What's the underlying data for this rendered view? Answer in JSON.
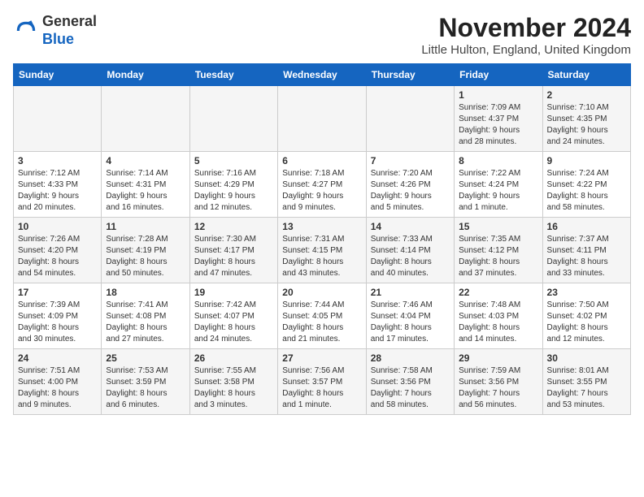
{
  "header": {
    "logo_line1": "General",
    "logo_line2": "Blue",
    "month_title": "November 2024",
    "location": "Little Hulton, England, United Kingdom"
  },
  "weekdays": [
    "Sunday",
    "Monday",
    "Tuesday",
    "Wednesday",
    "Thursday",
    "Friday",
    "Saturday"
  ],
  "weeks": [
    [
      {
        "day": "",
        "info": ""
      },
      {
        "day": "",
        "info": ""
      },
      {
        "day": "",
        "info": ""
      },
      {
        "day": "",
        "info": ""
      },
      {
        "day": "",
        "info": ""
      },
      {
        "day": "1",
        "info": "Sunrise: 7:09 AM\nSunset: 4:37 PM\nDaylight: 9 hours\nand 28 minutes."
      },
      {
        "day": "2",
        "info": "Sunrise: 7:10 AM\nSunset: 4:35 PM\nDaylight: 9 hours\nand 24 minutes."
      }
    ],
    [
      {
        "day": "3",
        "info": "Sunrise: 7:12 AM\nSunset: 4:33 PM\nDaylight: 9 hours\nand 20 minutes."
      },
      {
        "day": "4",
        "info": "Sunrise: 7:14 AM\nSunset: 4:31 PM\nDaylight: 9 hours\nand 16 minutes."
      },
      {
        "day": "5",
        "info": "Sunrise: 7:16 AM\nSunset: 4:29 PM\nDaylight: 9 hours\nand 12 minutes."
      },
      {
        "day": "6",
        "info": "Sunrise: 7:18 AM\nSunset: 4:27 PM\nDaylight: 9 hours\nand 9 minutes."
      },
      {
        "day": "7",
        "info": "Sunrise: 7:20 AM\nSunset: 4:26 PM\nDaylight: 9 hours\nand 5 minutes."
      },
      {
        "day": "8",
        "info": "Sunrise: 7:22 AM\nSunset: 4:24 PM\nDaylight: 9 hours\nand 1 minute."
      },
      {
        "day": "9",
        "info": "Sunrise: 7:24 AM\nSunset: 4:22 PM\nDaylight: 8 hours\nand 58 minutes."
      }
    ],
    [
      {
        "day": "10",
        "info": "Sunrise: 7:26 AM\nSunset: 4:20 PM\nDaylight: 8 hours\nand 54 minutes."
      },
      {
        "day": "11",
        "info": "Sunrise: 7:28 AM\nSunset: 4:19 PM\nDaylight: 8 hours\nand 50 minutes."
      },
      {
        "day": "12",
        "info": "Sunrise: 7:30 AM\nSunset: 4:17 PM\nDaylight: 8 hours\nand 47 minutes."
      },
      {
        "day": "13",
        "info": "Sunrise: 7:31 AM\nSunset: 4:15 PM\nDaylight: 8 hours\nand 43 minutes."
      },
      {
        "day": "14",
        "info": "Sunrise: 7:33 AM\nSunset: 4:14 PM\nDaylight: 8 hours\nand 40 minutes."
      },
      {
        "day": "15",
        "info": "Sunrise: 7:35 AM\nSunset: 4:12 PM\nDaylight: 8 hours\nand 37 minutes."
      },
      {
        "day": "16",
        "info": "Sunrise: 7:37 AM\nSunset: 4:11 PM\nDaylight: 8 hours\nand 33 minutes."
      }
    ],
    [
      {
        "day": "17",
        "info": "Sunrise: 7:39 AM\nSunset: 4:09 PM\nDaylight: 8 hours\nand 30 minutes."
      },
      {
        "day": "18",
        "info": "Sunrise: 7:41 AM\nSunset: 4:08 PM\nDaylight: 8 hours\nand 27 minutes."
      },
      {
        "day": "19",
        "info": "Sunrise: 7:42 AM\nSunset: 4:07 PM\nDaylight: 8 hours\nand 24 minutes."
      },
      {
        "day": "20",
        "info": "Sunrise: 7:44 AM\nSunset: 4:05 PM\nDaylight: 8 hours\nand 21 minutes."
      },
      {
        "day": "21",
        "info": "Sunrise: 7:46 AM\nSunset: 4:04 PM\nDaylight: 8 hours\nand 17 minutes."
      },
      {
        "day": "22",
        "info": "Sunrise: 7:48 AM\nSunset: 4:03 PM\nDaylight: 8 hours\nand 14 minutes."
      },
      {
        "day": "23",
        "info": "Sunrise: 7:50 AM\nSunset: 4:02 PM\nDaylight: 8 hours\nand 12 minutes."
      }
    ],
    [
      {
        "day": "24",
        "info": "Sunrise: 7:51 AM\nSunset: 4:00 PM\nDaylight: 8 hours\nand 9 minutes."
      },
      {
        "day": "25",
        "info": "Sunrise: 7:53 AM\nSunset: 3:59 PM\nDaylight: 8 hours\nand 6 minutes."
      },
      {
        "day": "26",
        "info": "Sunrise: 7:55 AM\nSunset: 3:58 PM\nDaylight: 8 hours\nand 3 minutes."
      },
      {
        "day": "27",
        "info": "Sunrise: 7:56 AM\nSunset: 3:57 PM\nDaylight: 8 hours\nand 1 minute."
      },
      {
        "day": "28",
        "info": "Sunrise: 7:58 AM\nSunset: 3:56 PM\nDaylight: 7 hours\nand 58 minutes."
      },
      {
        "day": "29",
        "info": "Sunrise: 7:59 AM\nSunset: 3:56 PM\nDaylight: 7 hours\nand 56 minutes."
      },
      {
        "day": "30",
        "info": "Sunrise: 8:01 AM\nSunset: 3:55 PM\nDaylight: 7 hours\nand 53 minutes."
      }
    ]
  ]
}
